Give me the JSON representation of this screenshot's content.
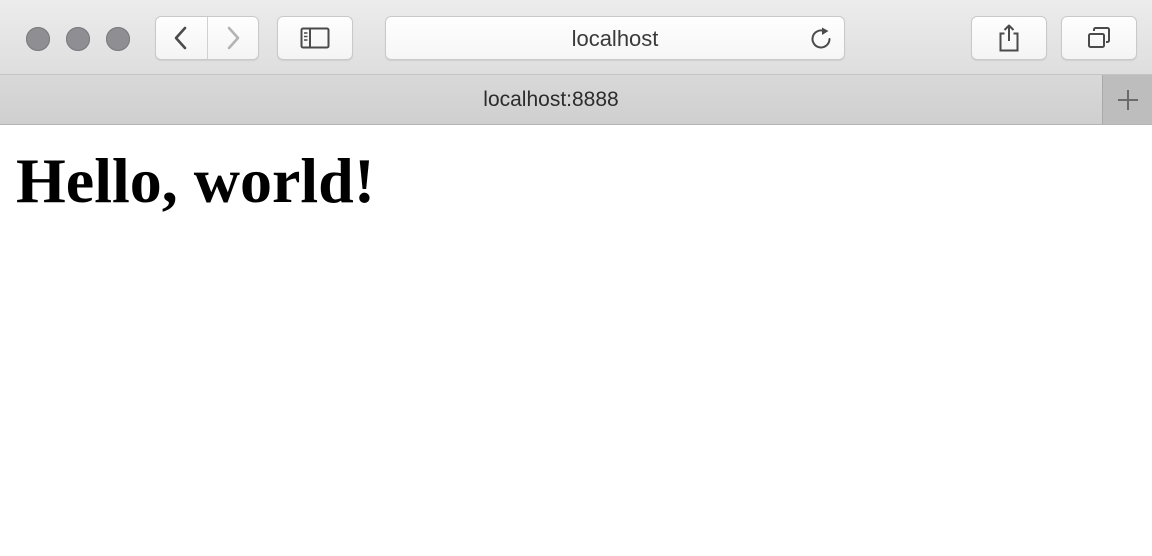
{
  "window": {
    "traffic_lights": [
      "close",
      "minimize",
      "zoom"
    ]
  },
  "toolbar": {
    "back_icon": "chevron-left-icon",
    "forward_icon": "chevron-right-icon",
    "sidebar_icon": "sidebar-icon",
    "share_icon": "share-icon",
    "tabs_icon": "tab-overview-icon"
  },
  "address_bar": {
    "text": "localhost",
    "reload_icon": "reload-icon"
  },
  "tab_bar": {
    "tabs": [
      {
        "title": "localhost:8888",
        "active": true
      }
    ],
    "new_tab_icon": "plus-icon"
  },
  "page": {
    "heading": "Hello, world!"
  },
  "colors": {
    "traffic_light_inactive": "#8e8e93",
    "toolbar_background": "#e4e4e4",
    "tab_bar_background": "#d4d4d4",
    "page_background": "#ffffff",
    "text": "#000000"
  }
}
